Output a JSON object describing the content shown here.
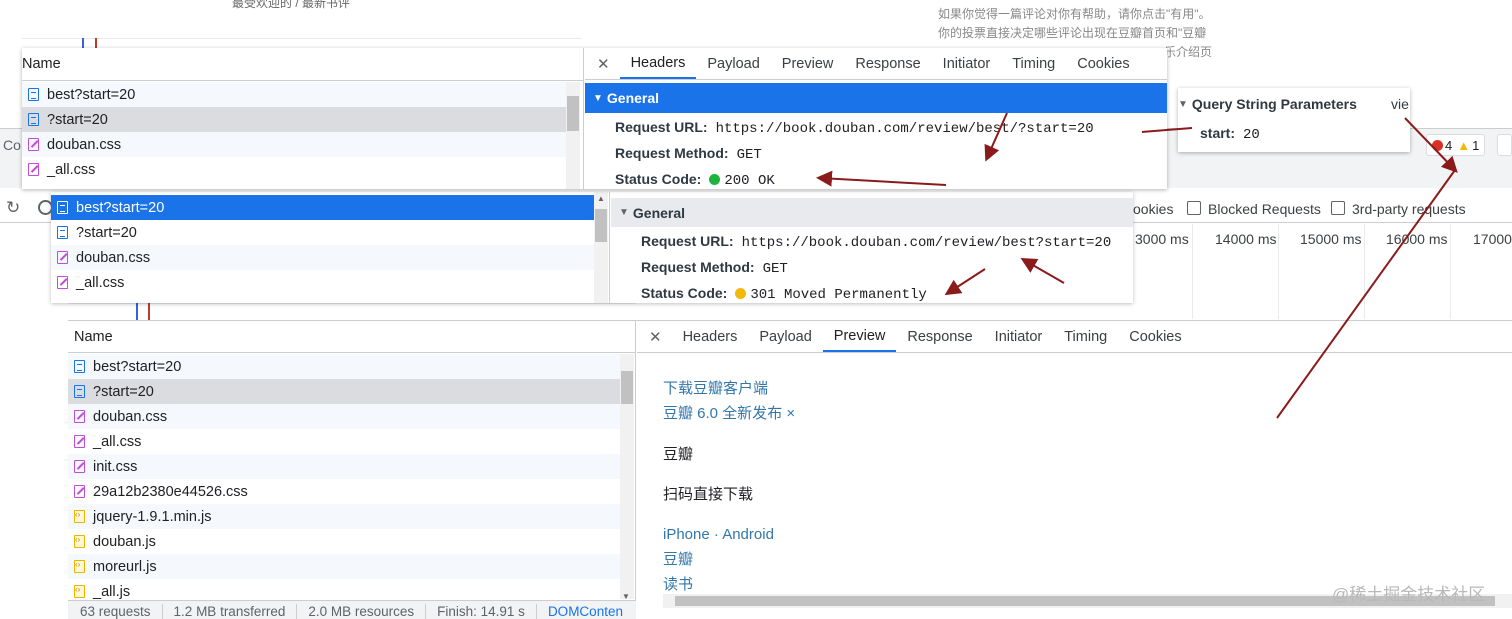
{
  "page_bg_text": {
    "top_left": "最受欢迎的 / 最新书评",
    "note_lines": [
      "如果你觉得一篇评论对你有帮助，请你点击\"有用\"。",
      "你的投票直接决定哪些评论出现在豆瓣首页和\"豆瓣",
      "乐介绍页"
    ],
    "console_stub": "Co",
    "error_count": "4",
    "warning_count": "1"
  },
  "filters": {
    "cookies_label": "ookies",
    "blocked_requests_label": "Blocked Requests",
    "third_party_label": "3rd-party requests"
  },
  "timeline": {
    "ticks": [
      "3000 ms",
      "14000 ms",
      "15000 ms",
      "16000 ms",
      "17000"
    ]
  },
  "panel1": {
    "list_header": "Name",
    "items": [
      {
        "name": "best?start=20",
        "type": "doc"
      },
      {
        "name": "?start=20",
        "type": "doc"
      },
      {
        "name": "douban.css",
        "type": "css"
      },
      {
        "name": "_all.css",
        "type": "css"
      }
    ],
    "tabs": [
      "Headers",
      "Payload",
      "Preview",
      "Response",
      "Initiator",
      "Timing",
      "Cookies"
    ],
    "general_title": "General",
    "request_url_label": "Request URL:",
    "request_url": "https://book.douban.com/review/best/?start=20",
    "request_method_label": "Request Method:",
    "request_method": "GET",
    "status_code_label": "Status Code:",
    "status_code": "200 OK",
    "status_color": "#1db43e"
  },
  "query_panel": {
    "title": "Query String Parameters",
    "view": "vie",
    "param_label": "start:",
    "param_value": "20"
  },
  "panel2": {
    "items": [
      {
        "name": "best?start=20",
        "type": "doc"
      },
      {
        "name": "?start=20",
        "type": "doc"
      },
      {
        "name": "douban.css",
        "type": "css"
      },
      {
        "name": "_all.css",
        "type": "css"
      }
    ],
    "general_title": "General",
    "request_url_label": "Request URL:",
    "request_url": "https://book.douban.com/review/best?start=20",
    "request_method_label": "Request Method:",
    "request_method": "GET",
    "status_code_label": "Status Code:",
    "status_code": "301 Moved Permanently",
    "status_color": "#f2b90a"
  },
  "panel3": {
    "list_header": "Name",
    "items": [
      {
        "name": "best?start=20",
        "type": "doc"
      },
      {
        "name": "?start=20",
        "type": "doc"
      },
      {
        "name": "douban.css",
        "type": "css"
      },
      {
        "name": "_all.css",
        "type": "css"
      },
      {
        "name": "init.css",
        "type": "css"
      },
      {
        "name": "29a12b2380e44526.css",
        "type": "css"
      },
      {
        "name": "jquery-1.9.1.min.js",
        "type": "js"
      },
      {
        "name": "douban.js",
        "type": "js"
      },
      {
        "name": "moreurl.js",
        "type": "js"
      },
      {
        "name": "_all.js",
        "type": "js"
      }
    ],
    "tabs": [
      "Headers",
      "Payload",
      "Preview",
      "Response",
      "Initiator",
      "Timing",
      "Cookies"
    ],
    "active_tab": "Preview",
    "status_bar": [
      "63 requests",
      "1.2 MB transferred",
      "2.0 MB resources",
      "Finish: 14.91 s",
      "DOMConten"
    ],
    "preview": {
      "line1": "下载豆瓣客户端",
      "line2": "豆瓣 6.0 全新发布 ×",
      "line3": "豆瓣",
      "line4": "扫码直接下载",
      "line5": "iPhone · Android",
      "line6": "豆瓣",
      "line7": "读书"
    }
  },
  "watermark": "@稀土掘金技术社区",
  "colors": {
    "accent": "#1a73e8",
    "arrow": "#8b1a1a",
    "selected_gray": "#dadce0"
  }
}
